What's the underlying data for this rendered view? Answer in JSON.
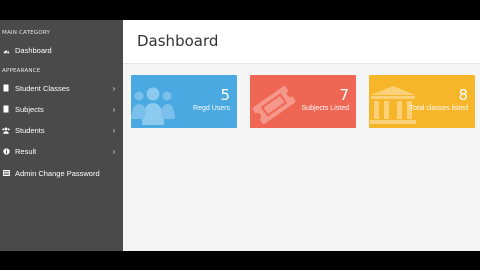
{
  "sidebar": {
    "main_category": "MAIN CATEGORY",
    "appearance": "APPEARANCE",
    "items": [
      {
        "label": "Dashboard",
        "icon": "dashboard-icon",
        "has_chevron": false
      },
      {
        "label": "Student Classes",
        "icon": "file-icon",
        "has_chevron": true
      },
      {
        "label": "Subjects",
        "icon": "file-icon",
        "has_chevron": true
      },
      {
        "label": "Students",
        "icon": "users-icon",
        "has_chevron": true
      },
      {
        "label": "Result",
        "icon": "info-icon",
        "has_chevron": true
      },
      {
        "label": "Admin Change Password",
        "icon": "list-icon",
        "has_chevron": false
      }
    ]
  },
  "header": {
    "title": "Dashboard"
  },
  "cards": [
    {
      "count": "5",
      "caption": "Regd Users",
      "color": "#4aa9e0",
      "icon": "users-icon"
    },
    {
      "count": "7",
      "caption": "Subjects Listed",
      "color": "#ef6654",
      "icon": "ticket-icon"
    },
    {
      "count": "8",
      "caption": "Total classes listed",
      "color": "#f7b52a",
      "icon": "bank-icon"
    }
  ]
}
